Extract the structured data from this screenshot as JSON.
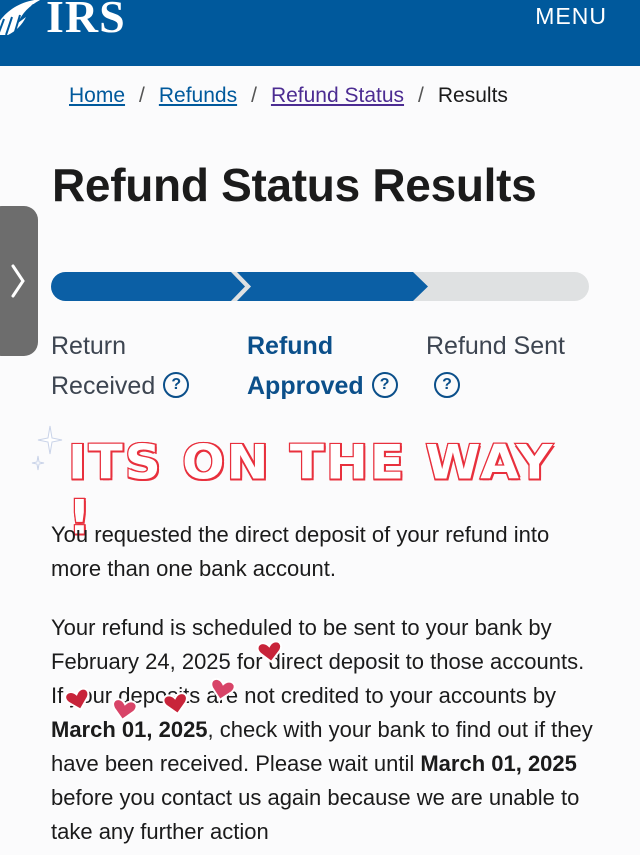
{
  "header": {
    "logo_text": "IRS",
    "menu_label": "MENU",
    "bg_color": "#00599c"
  },
  "breadcrumb": {
    "items": [
      "Home",
      "Refunds",
      "Refund Status"
    ],
    "current": "Results",
    "separator": "/"
  },
  "page_title": "Refund Status Results",
  "progress": {
    "completed_steps": 2,
    "total_steps": 3,
    "fill_color": "#0b5fa5",
    "track_color": "#dfe1e2",
    "steps": [
      {
        "line1": "Return",
        "line2": "Received",
        "help": "?"
      },
      {
        "line1": "Refund",
        "line2": "Approved",
        "help": "?"
      },
      {
        "line1": "Refund Sent",
        "line2": "",
        "help": "?"
      }
    ]
  },
  "overlay_caption": "ITS ON THE WAY !",
  "overlay_color": "#e8303d",
  "paragraph1": "You requested the direct deposit of your refund into more than one bank account.",
  "paragraph2": {
    "t1": "Your refund is scheduled to be sent to your bank by February 24, 2025 for direct deposit to those accounts. If your deposits are not credited to your accounts by ",
    "date1": "March 01, 2025",
    "t2": ", check with your bank to find out if they have been received. Please wait until ",
    "date2": "March 01, 2025",
    "t3": " before you contact us again because we are unable to take any further action"
  },
  "icons": {
    "logo": "eagle-logo-icon",
    "side_tab": "chevron-right-icon",
    "help": "question-circle-icon",
    "sparkle": "sparkle-icon",
    "heart": "heart-icon"
  }
}
